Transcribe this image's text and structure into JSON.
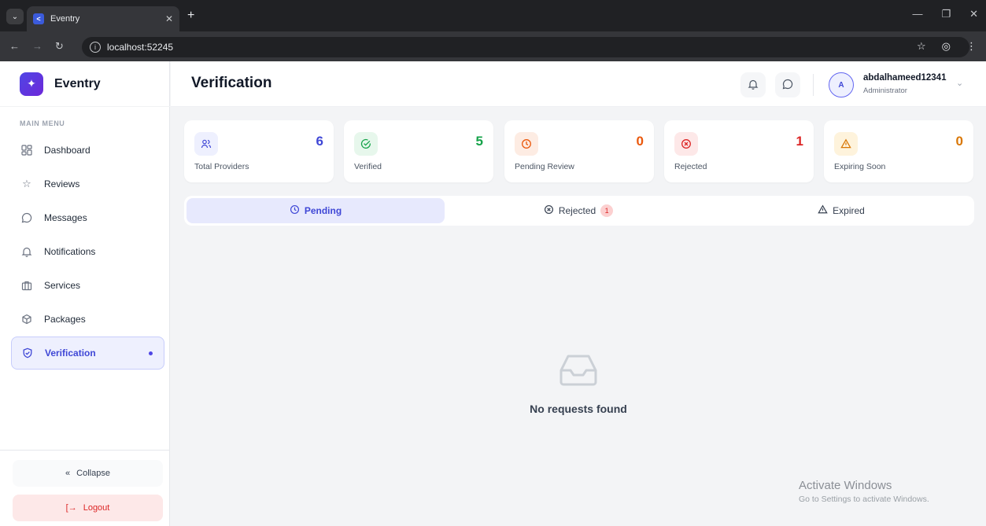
{
  "browser": {
    "tab_title": "Eventry",
    "url": "localhost:52245"
  },
  "sidebar": {
    "brand": "Eventry",
    "menu_heading": "MAIN MENU",
    "items": [
      {
        "label": "Dashboard",
        "icon": "grid-icon"
      },
      {
        "label": "Reviews",
        "icon": "star-icon"
      },
      {
        "label": "Messages",
        "icon": "chat-icon"
      },
      {
        "label": "Notifications",
        "icon": "bell-icon"
      },
      {
        "label": "Services",
        "icon": "briefcase-icon"
      },
      {
        "label": "Packages",
        "icon": "package-icon"
      },
      {
        "label": "Verification",
        "icon": "shield-icon",
        "active": true
      }
    ],
    "collapse_label": "Collapse",
    "logout_label": "Logout"
  },
  "header": {
    "title": "Verification",
    "avatar_initial": "A",
    "user_name": "abdalhameed12341",
    "user_role": "Administrator"
  },
  "stats": [
    {
      "label": "Total Providers",
      "value": "6",
      "color": "#3f47d6",
      "bg": "#eef0fe",
      "icon": "users-icon"
    },
    {
      "label": "Verified",
      "value": "5",
      "color": "#16a34a",
      "bg": "#e7f7ec",
      "icon": "check-circle-icon"
    },
    {
      "label": "Pending Review",
      "value": "0",
      "color": "#ea580c",
      "bg": "#fdece3",
      "icon": "clock-icon"
    },
    {
      "label": "Rejected",
      "value": "1",
      "color": "#dc2626",
      "bg": "#fde8e8",
      "icon": "x-circle-icon"
    },
    {
      "label": "Expiring Soon",
      "value": "0",
      "color": "#d97706",
      "bg": "#fef3dc",
      "icon": "warning-icon"
    }
  ],
  "tabs": [
    {
      "label": "Pending",
      "active": true
    },
    {
      "label": "Rejected",
      "badge": "1"
    },
    {
      "label": "Expired"
    }
  ],
  "empty_state": {
    "message": "No requests found"
  },
  "watermark": {
    "title": "Activate Windows",
    "subtitle": "Go to Settings to activate Windows."
  }
}
